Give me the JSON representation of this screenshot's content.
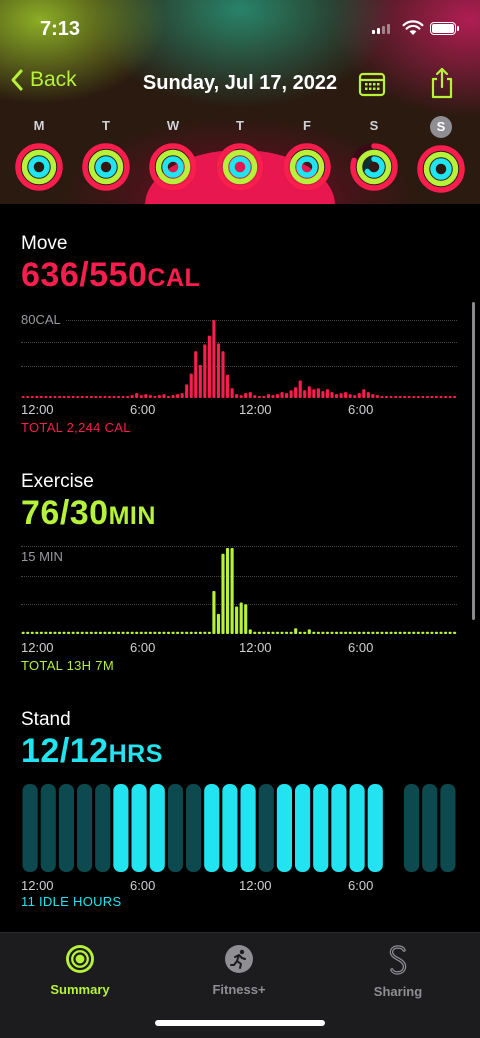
{
  "status_bar": {
    "time": "7:13"
  },
  "nav": {
    "back_label": "Back",
    "title": "Sunday, Jul 17, 2022"
  },
  "week": [
    {
      "letter": "M",
      "move": 1.0,
      "exercise": 1.0,
      "stand": 1.0,
      "selected": false
    },
    {
      "letter": "T",
      "move": 1.0,
      "exercise": 1.0,
      "stand": 1.0,
      "selected": false
    },
    {
      "letter": "W",
      "move": 1.0,
      "exercise": 1.0,
      "stand": 1.0,
      "selected": false
    },
    {
      "letter": "T",
      "move": 1.0,
      "exercise": 1.0,
      "stand": 1.0,
      "selected": false
    },
    {
      "letter": "F",
      "move": 1.0,
      "exercise": 1.0,
      "stand": 1.0,
      "selected": false
    },
    {
      "letter": "S",
      "move": 0.8,
      "exercise": 1.0,
      "stand": 0.65,
      "selected": false
    },
    {
      "letter": "S",
      "move": 1.0,
      "exercise": 1.0,
      "stand": 1.0,
      "selected": true
    }
  ],
  "colors": {
    "move": "#fa1e4e",
    "exercise": "#b6f23a",
    "stand": "#22e4f0",
    "accent": "#b6f23a"
  },
  "move": {
    "title": "Move",
    "value": "636/550",
    "unit": "CAL",
    "y_max_label": "80CAL",
    "x_labels": [
      "12:00",
      "6:00",
      "12:00",
      "6:00"
    ],
    "total": "TOTAL 2,244 CAL"
  },
  "exercise": {
    "title": "Exercise",
    "value": "76/30",
    "unit": "MIN",
    "y_max_label": "15 MIN",
    "x_labels": [
      "12:00",
      "6:00",
      "12:00",
      "6:00"
    ],
    "total": "TOTAL 13H 7M"
  },
  "stand": {
    "title": "Stand",
    "value": "12/12",
    "unit": "HRS",
    "x_labels": [
      "12:00",
      "6:00",
      "12:00",
      "6:00"
    ],
    "total": "11 IDLE HOURS"
  },
  "chart_data": [
    {
      "type": "bar",
      "title": "Move",
      "ylabel": "CAL",
      "ylim": [
        0,
        80
      ],
      "x_ticks": [
        "12:00",
        "6:00",
        "12:00",
        "6:00"
      ],
      "x": [
        0,
        0.25,
        0.5,
        0.75,
        1,
        1.25,
        1.5,
        1.75,
        2,
        2.25,
        2.5,
        2.75,
        3,
        3.25,
        3.5,
        3.75,
        4,
        4.25,
        4.5,
        4.75,
        5,
        5.25,
        5.5,
        5.75,
        6,
        6.25,
        6.5,
        6.75,
        7,
        7.25,
        7.5,
        7.75,
        8,
        8.25,
        8.5,
        8.75,
        9,
        9.25,
        9.5,
        9.75,
        10,
        10.25,
        10.5,
        10.75,
        11,
        11.25,
        11.5,
        11.75,
        12,
        12.25,
        12.5,
        12.75,
        13,
        13.25,
        13.5,
        13.75,
        14,
        14.25,
        14.5,
        14.75,
        15,
        15.25,
        15.5,
        15.75,
        16,
        16.25,
        16.5,
        16.75,
        17,
        17.25,
        17.5,
        17.75,
        18,
        18.25,
        18.5,
        18.75,
        19,
        19.25,
        19.5,
        19.75,
        20,
        20.25,
        20.5,
        20.75,
        21,
        21.25,
        21.5,
        21.75,
        22,
        22.25,
        22.5,
        22.75,
        23,
        23.25,
        23.5,
        23.75
      ],
      "values": [
        2,
        2,
        2,
        2,
        2,
        2,
        2,
        2,
        2,
        2,
        2,
        2,
        2,
        2,
        2,
        2,
        2,
        2,
        2,
        2,
        2,
        2,
        2,
        2,
        3,
        5,
        3,
        4,
        3,
        2,
        3,
        4,
        2,
        3,
        4,
        5,
        14,
        25,
        48,
        34,
        55,
        64,
        80,
        56,
        48,
        24,
        10,
        4,
        3,
        5,
        6,
        3,
        2,
        2,
        4,
        3,
        4,
        6,
        5,
        8,
        11,
        18,
        8,
        12,
        9,
        10,
        7,
        9,
        6,
        4,
        5,
        6,
        4,
        3,
        5,
        9,
        6,
        4,
        3,
        2,
        2,
        2,
        2,
        2,
        2,
        2,
        2,
        2,
        2,
        2,
        2,
        2,
        2,
        2,
        2,
        2
      ],
      "total_label": "TOTAL 2,244 CAL"
    },
    {
      "type": "bar",
      "title": "Exercise",
      "ylabel": "MIN",
      "ylim": [
        0,
        15
      ],
      "x_ticks": [
        "12:00",
        "6:00",
        "12:00",
        "6:00"
      ],
      "x": [
        0,
        0.25,
        0.5,
        0.75,
        1,
        1.25,
        1.5,
        1.75,
        2,
        2.25,
        2.5,
        2.75,
        3,
        3.25,
        3.5,
        3.75,
        4,
        4.25,
        4.5,
        4.75,
        5,
        5.25,
        5.5,
        5.75,
        6,
        6.25,
        6.5,
        6.75,
        7,
        7.25,
        7.5,
        7.75,
        8,
        8.25,
        8.5,
        8.75,
        9,
        9.25,
        9.5,
        9.75,
        10,
        10.25,
        10.5,
        10.75,
        11,
        11.25,
        11.5,
        11.75,
        12,
        12.25,
        12.5,
        12.75,
        13,
        13.25,
        13.5,
        13.75,
        14,
        14.25,
        14.5,
        14.75,
        15,
        15.25,
        15.5,
        15.75,
        16,
        16.25,
        16.5,
        16.75,
        17,
        17.25,
        17.5,
        17.75,
        18,
        18.25,
        18.5,
        18.75,
        19,
        19.25,
        19.5,
        19.75,
        20,
        20.25,
        20.5,
        20.75,
        21,
        21.25,
        21.5,
        21.75,
        22,
        22.25,
        22.5,
        22.75,
        23,
        23.25,
        23.5,
        23.75
      ],
      "values": [
        0.4,
        0.4,
        0.4,
        0.4,
        0.4,
        0.4,
        0.4,
        0.4,
        0.4,
        0.4,
        0.4,
        0.4,
        0.4,
        0.4,
        0.4,
        0.4,
        0.4,
        0.4,
        0.4,
        0.4,
        0.4,
        0.4,
        0.4,
        0.4,
        0.4,
        0.4,
        0.4,
        0.4,
        0.4,
        0.4,
        0.4,
        0.4,
        0.4,
        0.4,
        0.4,
        0.4,
        0.4,
        0.4,
        0.4,
        0.4,
        0.4,
        0.4,
        0.4,
        0.4,
        0.4,
        0.4,
        0.4,
        0.4,
        0.4,
        0.4,
        0.4,
        0.4,
        0.4,
        0.4,
        0.4,
        0.4,
        0.4,
        0.4,
        0.4,
        0.4,
        0.4,
        0.4,
        0.4,
        0.4,
        0.4,
        0.4,
        0.4,
        0.4,
        0.4,
        0.4,
        0.4,
        0.4,
        0.4,
        0.4,
        0.4,
        0.4,
        0.4,
        0.4,
        0.4,
        0.4,
        0.4,
        0.4,
        0.4,
        0.4,
        0.4,
        0.4,
        0.4,
        0.4,
        0.4,
        0.4,
        0.4,
        0.4,
        0.4,
        0.4,
        0.4,
        0.4
      ],
      "peaks": [
        {
          "x": 10.5,
          "value": 7.5
        },
        {
          "x": 10.75,
          "value": 3.5
        },
        {
          "x": 11.0,
          "value": 14
        },
        {
          "x": 11.25,
          "value": 15
        },
        {
          "x": 11.5,
          "value": 15
        },
        {
          "x": 11.75,
          "value": 4.8
        },
        {
          "x": 12.0,
          "value": 5.5
        },
        {
          "x": 12.25,
          "value": 5.2
        },
        {
          "x": 12.5,
          "value": 0.8
        },
        {
          "x": 15.0,
          "value": 1.0
        },
        {
          "x": 15.75,
          "value": 0.8
        }
      ],
      "total_label": "TOTAL 13H 7M"
    },
    {
      "type": "bar",
      "title": "Stand",
      "x_ticks": [
        "12:00",
        "6:00",
        "12:00",
        "6:00"
      ],
      "hours": [
        "0",
        "1",
        "2",
        "3",
        "4",
        "5",
        "6",
        "7",
        "8",
        "9",
        "10",
        "11",
        "12",
        "13",
        "14",
        "15",
        "16",
        "17",
        "18",
        "19",
        "20",
        "21",
        "22",
        "23"
      ],
      "stood": [
        0,
        0,
        0,
        0,
        0,
        1,
        1,
        1,
        0,
        0,
        1,
        1,
        1,
        0,
        1,
        1,
        1,
        1,
        1,
        1,
        null,
        0,
        0,
        0
      ],
      "total_label": "11 IDLE HOURS"
    }
  ],
  "tabs": [
    {
      "label": "Summary",
      "icon": "rings-icon",
      "active": true
    },
    {
      "label": "Fitness+",
      "icon": "runner-icon",
      "active": false
    },
    {
      "label": "Sharing",
      "icon": "sharing-icon",
      "active": false
    }
  ]
}
